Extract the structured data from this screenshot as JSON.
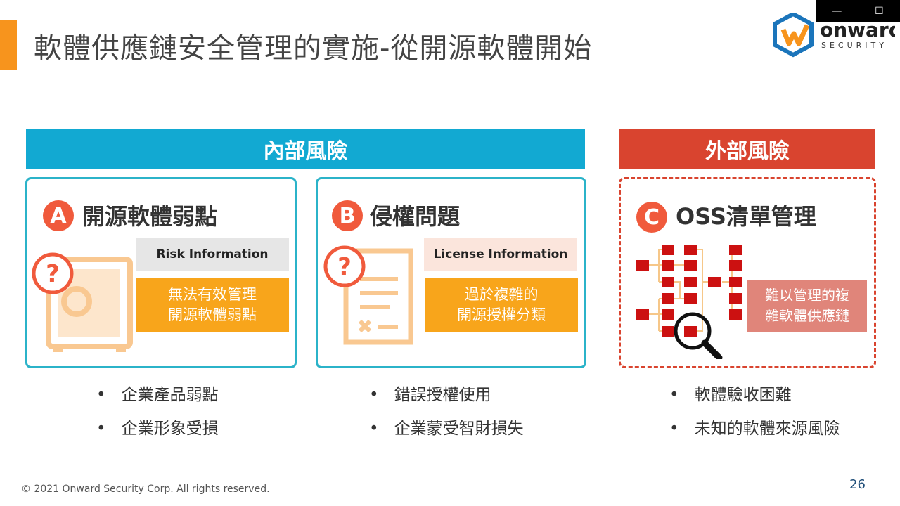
{
  "window": {
    "minimize_icon": "minimize-icon",
    "maximize_icon": "maximize-icon"
  },
  "slide": {
    "title": "軟體供應鏈安全管理的實施-從開源軟體開始",
    "logo": {
      "text": "onward",
      "subtext": "SECURITY"
    },
    "internal_header": "內部風險",
    "external_header": "外部風險",
    "colors": {
      "accent": "#f7941d",
      "internal": "#12a9d2",
      "external": "#d9442f",
      "orange": "#f8a51b",
      "salmon": "#e0857a"
    },
    "cards": [
      {
        "badge": "A",
        "title": "開源軟體弱點",
        "info": "Risk Information",
        "box": [
          "無法有效管理",
          "開源軟體弱點"
        ],
        "icon": "vulnerable-safe-icon",
        "bullets": [
          "企業產品弱點",
          "企業形象受損"
        ]
      },
      {
        "badge": "B",
        "title": "侵權問題",
        "info": "License Information",
        "box": [
          "過於複雜的",
          "開源授權分類"
        ],
        "icon": "license-document-icon",
        "bullets": [
          "錯誤授權使用",
          "企業蒙受智財損失"
        ]
      },
      {
        "badge": "C",
        "title": "OSS清單管理",
        "box": [
          "難以管理的複",
          "雜軟體供應鏈"
        ],
        "icon": "dependency-tree-icon",
        "bullets": [
          "軟體驗收困難",
          "未知的軟體來源風險"
        ]
      }
    ],
    "footer": "© 2021 Onward Security Corp. All rights reserved.",
    "page_number": "26"
  }
}
